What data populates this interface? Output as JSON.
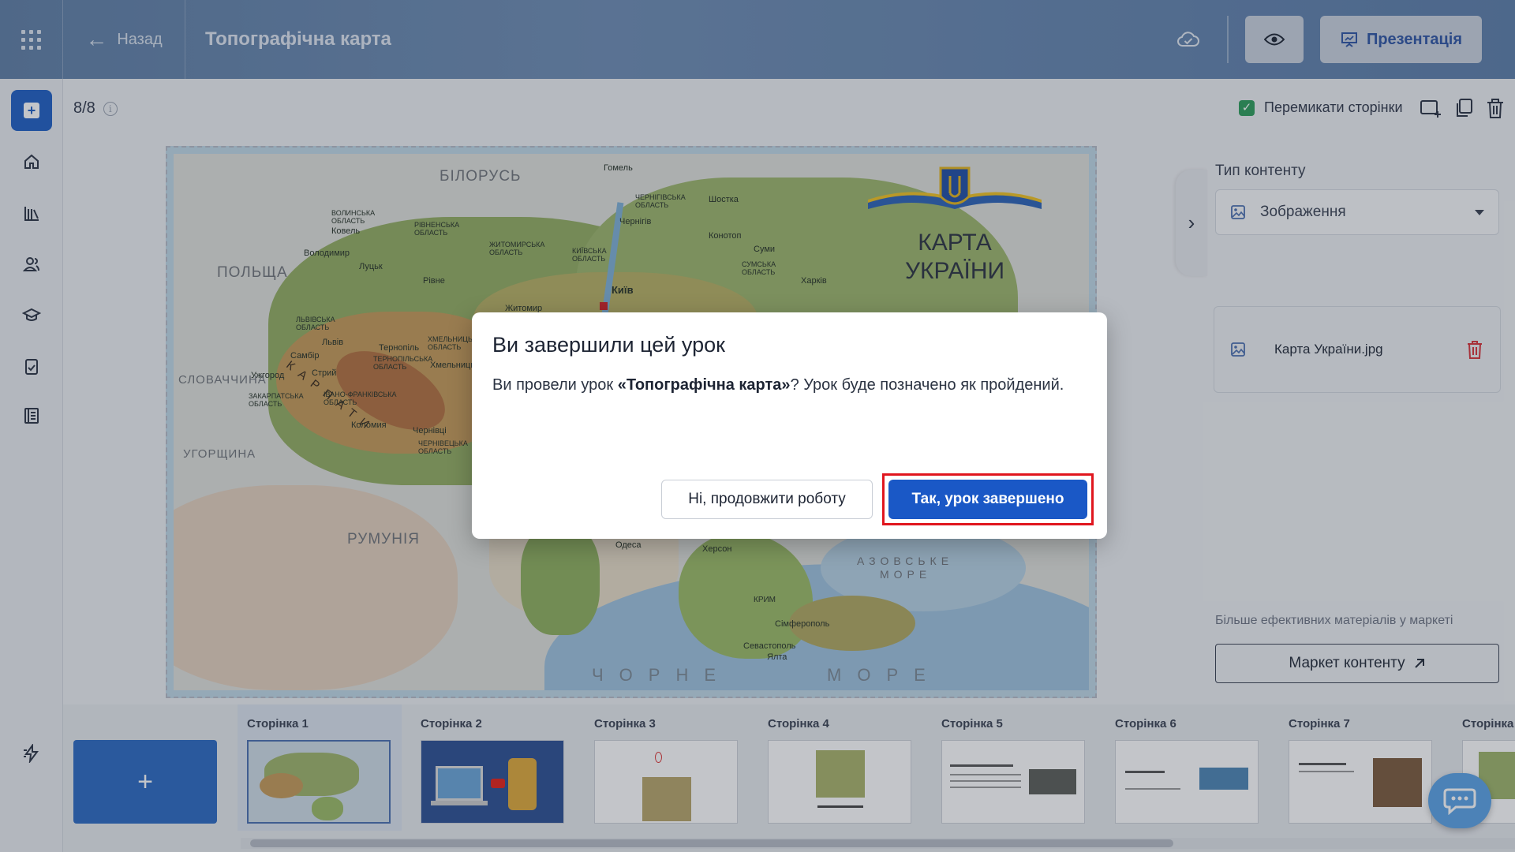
{
  "header": {
    "back_label": "Назад",
    "title": "Топографічна карта",
    "presentation_label": "Презентація"
  },
  "editor": {
    "page_counter": "8/8",
    "toggle_pages_label": "Перемикати сторінки",
    "toggle_pages_checked": true
  },
  "map": {
    "title_line1": "КАРТА",
    "title_line2": "УКРАЇНИ",
    "labels": {
      "belarus": "БІЛОРУСЬ",
      "poland": "ПОЛЬЩА",
      "slovakia": "СЛОВАЧЧИНА",
      "hungary": "УГОРЩИНА",
      "romania": "РУМУНІЯ",
      "black_sea_1": "ЧОРНЕ",
      "black_sea_2": "МОРЕ",
      "azov_1": "АЗОВСЬКЕ",
      "azov_2": "МОРЕ",
      "carpathians": "КАРПАТИ"
    },
    "cities": [
      "Київ",
      "Житомир",
      "Рівне",
      "Луцьк",
      "Львів",
      "Тернопіль",
      "Чернівці",
      "Ужгород",
      "Хмельницький",
      "Чернігів",
      "Суми",
      "Харків",
      "Одеса",
      "Херсон",
      "Сімферополь",
      "Севастополь",
      "Ялта",
      "Гомель",
      "Шостка",
      "Конотоп",
      "Ковель",
      "Володимир",
      "Стрий",
      "Самбір",
      "Коломия"
    ],
    "regions": [
      "ВОЛИНСЬКА ОБЛАСТЬ",
      "РІВНЕНСЬКА ОБЛАСТЬ",
      "ЖИТОМИРСЬКА ОБЛАСТЬ",
      "КИЇВСЬКА ОБЛАСТЬ",
      "ЧЕРНІГІВСЬКА ОБЛАСТЬ",
      "СУМСЬКА ОБЛАСТЬ",
      "ЛЬВІВСЬКА ОБЛАСТЬ",
      "ТЕРНОПІЛЬСЬКА ОБЛАСТЬ",
      "ХМЕЛЬНИЦЬКА ОБЛАСТЬ",
      "ЗАКАРПАТСЬКА ОБЛАСТЬ",
      "ІВАНО-ФРАНКІВСЬКА ОБЛАСТЬ",
      "ЧЕРНІВЕЦЬКА ОБЛАСТЬ",
      "КРИМ"
    ]
  },
  "right_panel": {
    "content_type_label": "Тип контенту",
    "content_type_value": "Зображення",
    "file_name": "Карта України.jpg",
    "market_note": "Більше ефективних матеріалів у маркеті",
    "market_button": "Маркет контенту"
  },
  "pages": [
    {
      "label": "Сторінка 1"
    },
    {
      "label": "Сторінка 2"
    },
    {
      "label": "Сторінка 3"
    },
    {
      "label": "Сторінка 4"
    },
    {
      "label": "Сторінка 5"
    },
    {
      "label": "Сторінка 6"
    },
    {
      "label": "Сторінка 7"
    },
    {
      "label": "Сторінка"
    }
  ],
  "add_page_label": "+",
  "modal": {
    "title": "Ви завершили цей урок",
    "text_before": "Ви провели урок ",
    "lesson_name": "«Топографічна карта»",
    "text_after": "? Урок буде позначено як пройдений.",
    "cancel_button": "Ні, продовжити роботу",
    "confirm_button": "Так, урок завершено"
  },
  "colors": {
    "primary": "#1a58c6",
    "highlight_frame": "#e0161e",
    "header": "#6e8db4",
    "checkbox": "#2d9d5a",
    "danger_icon": "#d9333a"
  }
}
